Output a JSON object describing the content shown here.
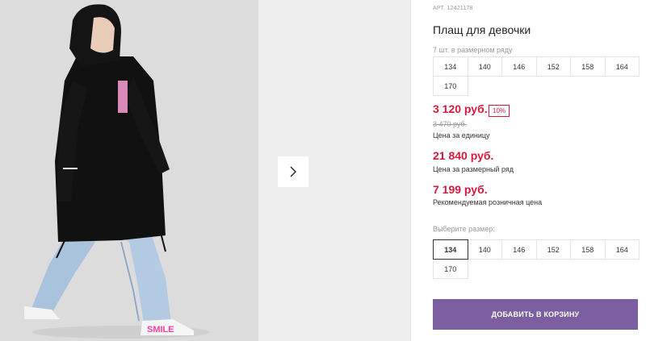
{
  "gallery": {
    "image_alt": "Girl in black hooded coat and light blue jeans",
    "next_icon": "chevron-right-icon"
  },
  "product": {
    "sku": "АРТ. 12421178",
    "title": "Плащ для девочки",
    "pack_note": "7 шт. в размерном ряду",
    "pack_sizes": [
      "134",
      "140",
      "146",
      "152",
      "158",
      "164",
      "170"
    ],
    "price": "3 120 руб.",
    "discount": "10%",
    "old_price": "3 470 руб.",
    "price_caption": "Цена за единицу",
    "pack_price": "21 840 руб.",
    "pack_price_caption": "Цена за размерный ряд",
    "rrp": "7 199 руб.",
    "rrp_caption": "Рекомендуемая розничная цена",
    "choose_size_label": "Выберите размер:",
    "sizes": [
      "134",
      "140",
      "146",
      "152",
      "158",
      "164",
      "170"
    ],
    "selected_size": "134",
    "add_to_cart": "Добавить в корзину"
  },
  "colors": {
    "accent_price": "#d7193c",
    "button": "#7b5fa0"
  }
}
